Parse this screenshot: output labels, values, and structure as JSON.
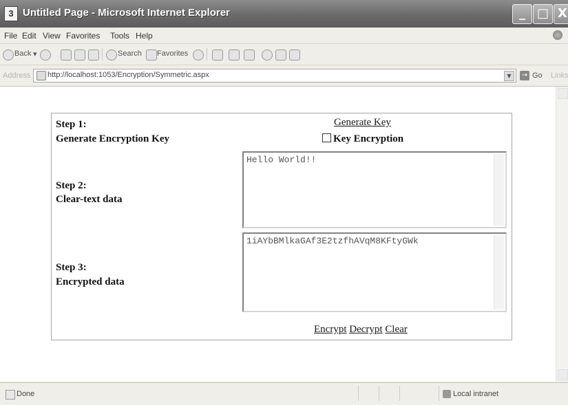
{
  "window": {
    "title": "Untitled Page - Microsoft Internet Explorer",
    "icon_glyph": "3",
    "min_glyph": "_",
    "max_glyph": "□",
    "close_glyph": "X"
  },
  "menu": {
    "items": [
      "File",
      "Edit",
      "View",
      "Favorites",
      "Tools",
      "Help"
    ]
  },
  "toolbar": {
    "back_label": "Back",
    "search_label": "Search",
    "favorites_label": "Favorites"
  },
  "address": {
    "label": "Address",
    "url": "http://localhost:1053/Encryption/Symmetric.aspx",
    "go_label": "Go",
    "links_label": "Links"
  },
  "page": {
    "step1_title": "Step 1:",
    "step1_text": "Generate Encryption Key",
    "generate_key_link": "Generate Key",
    "key_encryption_label": "Key Encryption",
    "step2_title": "Step 2:",
    "step2_text": "Clear-text data",
    "cleartext_value": "Hello World!!",
    "step3_title": "Step 3:",
    "step3_text": "Encrypted data",
    "encrypted_value": "1iAYbBMlkaGAf3E2tzfhAVqM8KFtyGWk",
    "encrypt_label": "Encrypt",
    "decrypt_label": "Decrypt",
    "clear_label": "Clear"
  },
  "status": {
    "text": "Done",
    "zone": "Local intranet"
  }
}
